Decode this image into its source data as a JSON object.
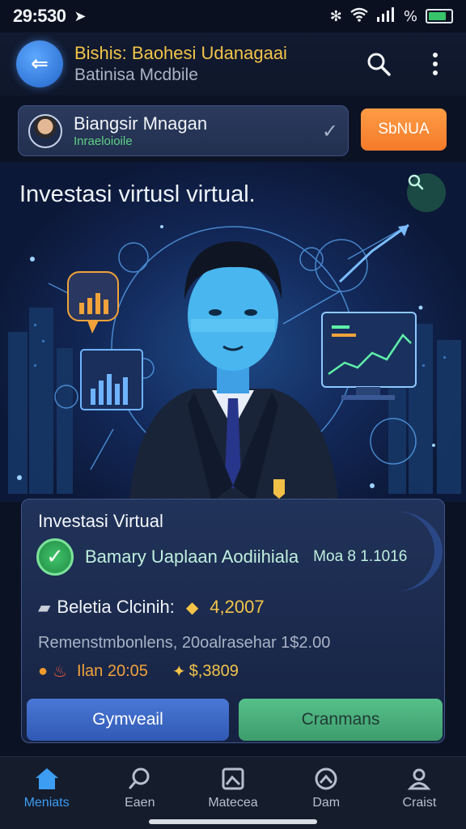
{
  "status_bar": {
    "time": "29:530",
    "battery_level": 0.8
  },
  "header": {
    "title": "Bishis: Baohesi Udanagaai",
    "subtitle": "Batinisa Mcdbile",
    "back_icon": "back-arrow-icon",
    "search_icon": "search-icon",
    "menu_icon": "more-vertical-icon"
  },
  "profile": {
    "name": "Biangsir Mnagan",
    "role": "Inraeloioile",
    "status_button": "SbNUA"
  },
  "hero": {
    "title": "Investasi virtusl virtual."
  },
  "card": {
    "title": "Investasi Virtual",
    "status_text": "Bamary Uaplaan Aodiihiala",
    "status_amount": "Moa 8 1.1016",
    "balance_label": "Beletia Clcinih:",
    "balance_value": "4,2007",
    "description": "Remenstmbonlens, 20oalrasehar 1$2.00",
    "stat_date": "Ilan 20:05",
    "stat_value": "$,3809",
    "primary_button": "Gymveail",
    "secondary_button": "Cranmans"
  },
  "bottom_nav": [
    {
      "label": "Meniats",
      "icon": "home-icon"
    },
    {
      "label": "Eaen",
      "icon": "search-chat-icon"
    },
    {
      "label": "Matecea",
      "icon": "image-frame-icon"
    },
    {
      "label": "Dam",
      "icon": "gauge-icon"
    },
    {
      "label": "Craist",
      "icon": "profile-icon"
    }
  ],
  "colors": {
    "accent_blue": "#3d9df2",
    "gold": "#f3c448",
    "orange": "#f47b2a",
    "green": "#3fc56b"
  }
}
